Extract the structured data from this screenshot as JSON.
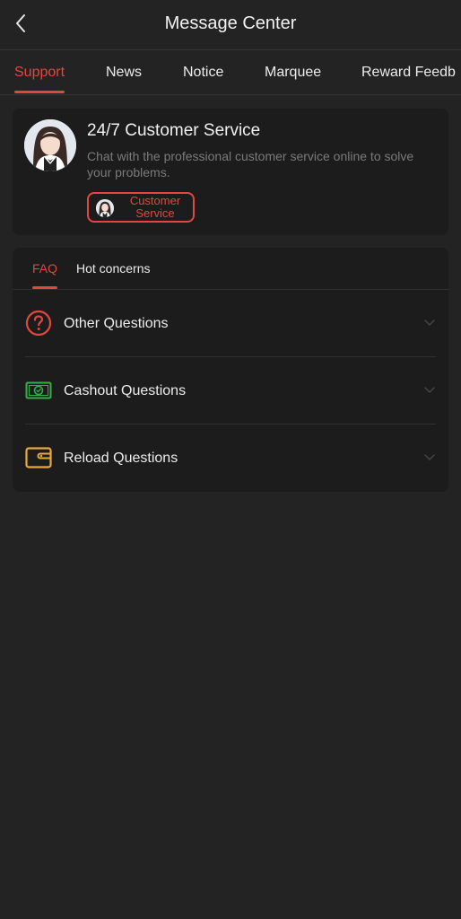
{
  "header": {
    "title": "Message Center"
  },
  "top_tabs": [
    {
      "label": "Support",
      "active": true
    },
    {
      "label": "News",
      "active": false
    },
    {
      "label": "Notice",
      "active": false
    },
    {
      "label": "Marquee",
      "active": false
    },
    {
      "label": "Reward Feedb",
      "active": false
    }
  ],
  "service_card": {
    "title": "24/7 Customer Service",
    "description": "Chat with the professional customer service online to solve your problems.",
    "button_label": "Customer Service"
  },
  "faq": {
    "tabs": [
      {
        "label": "FAQ",
        "active": true
      },
      {
        "label": "Hot concerns",
        "active": false
      }
    ],
    "items": [
      {
        "label": "Other Questions",
        "icon": "question-circle-icon",
        "color": "#e0483f"
      },
      {
        "label": "Cashout Questions",
        "icon": "cash-icon",
        "color": "#2fb24a"
      },
      {
        "label": "Reload Questions",
        "icon": "wallet-icon",
        "color": "#e8a93a"
      }
    ]
  },
  "colors": {
    "background": "#232323",
    "card": "#1c1c1c",
    "accent": "#e0483f",
    "muted_text": "#7a7a7a"
  }
}
